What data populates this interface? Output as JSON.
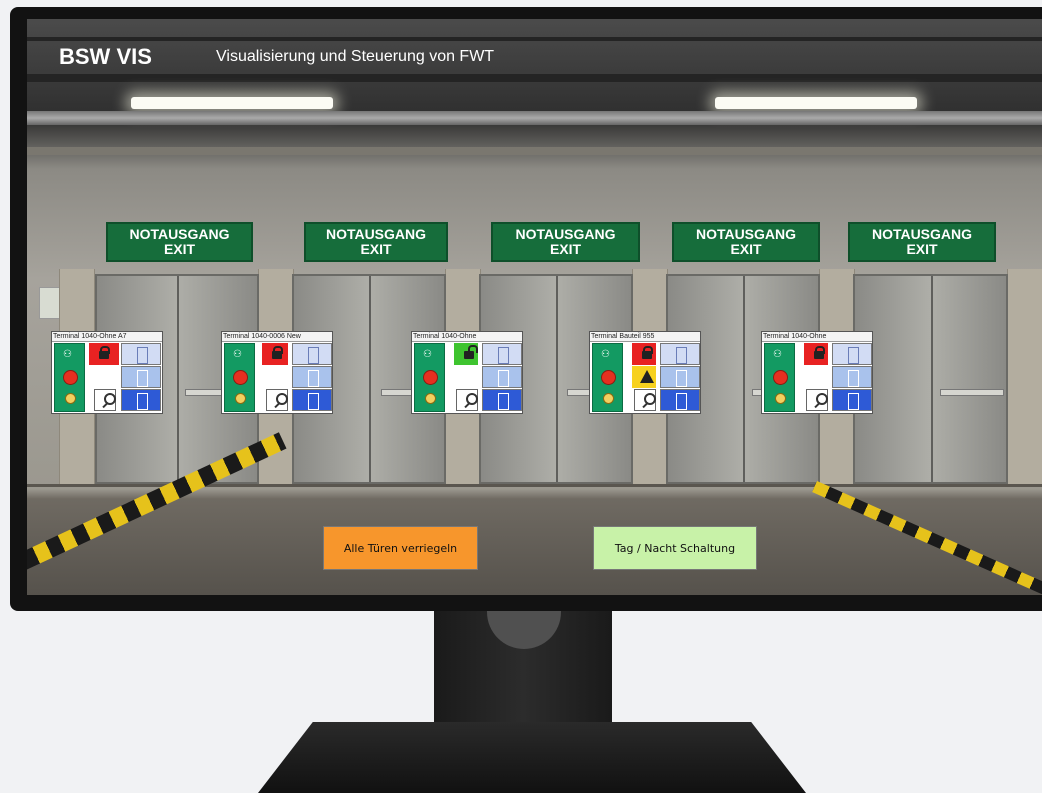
{
  "header": {
    "app_title": "BSW VIS",
    "app_subtitle": "Visualisierung und Steuerung von FWT"
  },
  "exit_signs": [
    {
      "line1": "NOTAUSGANG",
      "line2": "EXIT"
    },
    {
      "line1": "NOTAUSGANG",
      "line2": "EXIT"
    },
    {
      "line1": "NOTAUSGANG",
      "line2": "EXIT"
    },
    {
      "line1": "NOTAUSGANG",
      "line2": "EXIT"
    },
    {
      "line1": "NOTAUSGANG",
      "line2": "EXIT"
    }
  ],
  "terminals": [
    {
      "title": "Terminal 1040-Ohne A7",
      "lock_state": "locked",
      "warning": false
    },
    {
      "title": "Terminal 1040-0006 New",
      "lock_state": "locked",
      "warning": false
    },
    {
      "title": "Terminal 1040-Ohne",
      "lock_state": "unlocked",
      "warning": false
    },
    {
      "title": "Terminal Bauteil 955",
      "lock_state": "locked",
      "warning": true
    },
    {
      "title": "Terminal 1040-Ohne",
      "lock_state": "locked",
      "warning": false
    }
  ],
  "buttons": {
    "lock_all": "Alle Türen verriegeln",
    "day_night": "Tag / Nacht Schaltung"
  },
  "colors": {
    "lock_all_bg": "#f7962c",
    "day_night_bg": "#c8f2a8",
    "locked": "#e82222",
    "unlocked": "#3ec42f",
    "warning": "#f7d11f",
    "exit_green": "#166d3b"
  }
}
